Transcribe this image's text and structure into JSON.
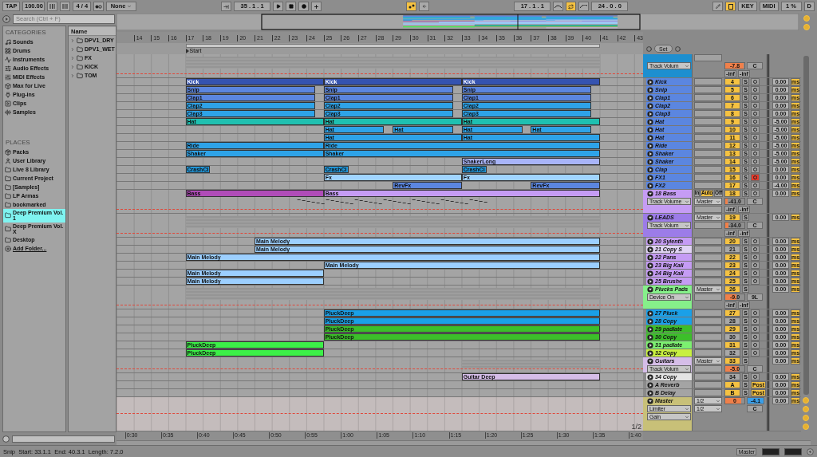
{
  "transport": {
    "tap": "TAP",
    "tempo": "100.00",
    "signature": "4 / 4",
    "quantize": "None",
    "position": "35 .  1 .  1",
    "loop_start": "17 .  1 .  1",
    "loop_on": true,
    "loop_length": "24 .  0 .  0",
    "key": "KEY",
    "midi": "MIDI",
    "cpu": "1 %",
    "disk": "D"
  },
  "browser": {
    "search_placeholder": "Search (Ctrl + F)",
    "categories_title": "CATEGORIES",
    "categories": [
      {
        "label": "Sounds",
        "selected": false
      },
      {
        "label": "Drums",
        "selected": false
      },
      {
        "label": "Instruments",
        "selected": false
      },
      {
        "label": "Audio Effects",
        "selected": false
      },
      {
        "label": "MIDI Effects",
        "selected": false
      },
      {
        "label": "Max for Live",
        "selected": false
      },
      {
        "label": "Plug-ins",
        "selected": false
      },
      {
        "label": "Clips",
        "selected": false
      },
      {
        "label": "Samples",
        "selected": false
      }
    ],
    "places_title": "PLACES",
    "places": [
      {
        "label": "Packs",
        "selected": false
      },
      {
        "label": "User Library",
        "selected": false
      },
      {
        "label": "Live 8 Library",
        "selected": false
      },
      {
        "label": "Current Project",
        "selected": false
      },
      {
        "label": "[Samples]",
        "selected": false
      },
      {
        "label": "LP Armas",
        "selected": false
      },
      {
        "label": "bookmarked",
        "selected": false
      },
      {
        "label": "Deep Premium Vol. 1",
        "selected": true
      },
      {
        "label": "Deep Premium Vol. X",
        "selected": false
      },
      {
        "label": "Desktop",
        "selected": false
      }
    ],
    "add_folder": "Add Folder...",
    "column": "Name",
    "folders": [
      "DPV1_DRY",
      "DPV1_WET",
      "FX",
      "KICK",
      "TOM"
    ]
  },
  "ruler": {
    "bars": [
      "14",
      "15",
      "16",
      "17",
      "18",
      "19",
      "20",
      "21",
      "22",
      "23",
      "24",
      "25",
      "26",
      "27",
      "28",
      "29",
      "30",
      "31",
      "32",
      "33",
      "34",
      "35",
      "36",
      "37",
      "38",
      "39",
      "40",
      "41",
      "42",
      "43"
    ],
    "start_marker": "Start"
  },
  "set_button": "Set",
  "tracks": [
    {
      "kind": "group",
      "color": "#1d8fd0",
      "device": "Track Volum",
      "volume": {
        "text": "-7.8",
        "level": 0.95
      },
      "pan": "C",
      "inf": [
        "-inf",
        "-inf"
      ]
    },
    {
      "kind": "track",
      "name": "Kick",
      "color": "#5b86e0",
      "number": "4",
      "active": true,
      "solo": "S",
      "armed": false,
      "delay": "0.00",
      "unit": "ms",
      "clips": [
        {
          "name": "Kick",
          "color": "#3553b0"
        },
        {
          "name": "Kick",
          "color": "#3553b0"
        },
        {
          "name": "Kick",
          "color": "#3553b0"
        }
      ]
    },
    {
      "kind": "track",
      "name": "Snip",
      "color": "#5b86e0",
      "number": "5",
      "active": true,
      "solo": "S",
      "armed": false,
      "delay": "0.00",
      "unit": "ms",
      "clips": [
        {
          "name": "Snip",
          "color": "#5b86e0"
        },
        {
          "name": "Snip",
          "color": "#5b86e0"
        },
        {
          "name": "Snip",
          "color": "#5b86e0"
        }
      ]
    },
    {
      "kind": "track",
      "name": "Clap1",
      "color": "#5b86e0",
      "number": "6",
      "active": true,
      "solo": "S",
      "armed": false,
      "delay": "0.00",
      "unit": "ms",
      "clips": [
        {
          "name": "Clap1",
          "color": "#5b86e0"
        },
        {
          "name": "Clap1",
          "color": "#5b86e0"
        },
        {
          "name": "Clap1",
          "color": "#5b86e0"
        }
      ]
    },
    {
      "kind": "track",
      "name": "Clap2",
      "color": "#5b86e0",
      "number": "7",
      "active": true,
      "solo": "S",
      "armed": false,
      "delay": "0.00",
      "unit": "ms",
      "clips": [
        {
          "name": "Clap2",
          "color": "#2ea3e8"
        },
        {
          "name": "Clap2",
          "color": "#2ea3e8"
        },
        {
          "name": "Clap2",
          "color": "#2ea3e8"
        }
      ]
    },
    {
      "kind": "track",
      "name": "Clap3",
      "color": "#5b86e0",
      "number": "8",
      "active": true,
      "solo": "S",
      "armed": false,
      "delay": "0.00",
      "unit": "ms",
      "clips": [
        {
          "name": "Clap3",
          "color": "#2ea3e8"
        },
        {
          "name": "Clap3",
          "color": "#2ea3e8"
        },
        {
          "name": "Clap3",
          "color": "#2ea3e8"
        }
      ]
    },
    {
      "kind": "track",
      "name": "Hat",
      "color": "#5b86e0",
      "number": "9",
      "active": true,
      "solo": "S",
      "armed": false,
      "delay": "-5.00",
      "unit": "ms",
      "clips": [
        {
          "name": "Hat",
          "color": "#1fc0b0"
        },
        {
          "name": "Hat",
          "color": "#1fc0b0"
        },
        {
          "name": "Hat",
          "color": "#1fc0b0"
        }
      ]
    },
    {
      "kind": "track",
      "name": "Hat",
      "color": "#5b86e0",
      "number": "10",
      "active": true,
      "solo": "S",
      "armed": false,
      "delay": "-5.00",
      "unit": "ms",
      "clips": [
        {
          "name": "Hat",
          "color": "#2ea3e8"
        },
        {
          "name": "Hat",
          "color": "#2ea3e8"
        },
        {
          "name": "Hat",
          "color": "#2ea3e8"
        },
        {
          "name": "Hat",
          "color": "#2ea3e8"
        }
      ]
    },
    {
      "kind": "track",
      "name": "Hat",
      "color": "#5b86e0",
      "number": "11",
      "active": true,
      "solo": "S",
      "armed": false,
      "delay": "-5.00",
      "unit": "ms",
      "clips": [
        {
          "name": "Hat",
          "color": "#2ea3e8"
        },
        {
          "name": "Hat",
          "color": "#2ea3e8"
        }
      ]
    },
    {
      "kind": "track",
      "name": "Ride",
      "color": "#5b86e0",
      "number": "12",
      "active": true,
      "solo": "S",
      "armed": false,
      "delay": "-5.00",
      "unit": "ms",
      "clips": [
        {
          "name": "Ride",
          "color": "#2ea3e8"
        },
        {
          "name": "Ride",
          "color": "#2ea3e8"
        }
      ]
    },
    {
      "kind": "track",
      "name": "Shaker",
      "color": "#5b86e0",
      "number": "13",
      "active": true,
      "solo": "S",
      "armed": false,
      "delay": "-5.00",
      "unit": "ms",
      "clips": [
        {
          "name": "Shaker",
          "color": "#2ea3e8"
        },
        {
          "name": "Shaker",
          "color": "#2ea3e8"
        }
      ]
    },
    {
      "kind": "track",
      "name": "Shaker",
      "color": "#5b86e0",
      "number": "14",
      "active": true,
      "solo": "S",
      "armed": false,
      "delay": "-5.00",
      "unit": "ms",
      "clips": [
        {
          "name": "ShakerLong",
          "color": "#a8b4f8"
        }
      ]
    },
    {
      "kind": "track",
      "name": "Clap",
      "color": "#5b86e0",
      "number": "15",
      "active": true,
      "solo": "S",
      "armed": false,
      "delay": "0.00",
      "unit": "ms",
      "clips": [
        {
          "name": "CrashCl",
          "color": "#2196d8"
        },
        {
          "name": "CrashCl",
          "color": "#2196d8"
        },
        {
          "name": "CrashCl",
          "color": "#2196d8"
        }
      ]
    },
    {
      "kind": "track",
      "name": "FX1",
      "color": "#5b86e0",
      "number": "16",
      "active": true,
      "solo": "S",
      "armed": true,
      "delay": "0.00",
      "unit": "ms",
      "clips": [
        {
          "name": "Fx",
          "color": "#a0d4ff"
        },
        {
          "name": "Fx",
          "color": "#a0d4ff"
        }
      ]
    },
    {
      "kind": "track",
      "name": "FX2",
      "color": "#5b86e0",
      "number": "17",
      "active": true,
      "solo": "S",
      "armed": false,
      "delay": "-4.00",
      "unit": "ms",
      "clips": [
        {
          "name": "RevFx",
          "color": "#5b86e0"
        },
        {
          "name": "RevFx",
          "color": "#5b86e0"
        }
      ]
    },
    {
      "kind": "midi",
      "name": "18 Bass",
      "color": "#c59cf4",
      "monitor": [
        {
          "label": "In",
          "selected": false
        },
        {
          "label": "Auto",
          "selected": true
        },
        {
          "label": "Off",
          "selected": false
        }
      ],
      "output": "Master",
      "device": "Track Volume",
      "number": "18",
      "active": true,
      "solo": "S",
      "armed": false,
      "volume": {
        "text": "-41.0",
        "level": 0.12
      },
      "pan": "C",
      "inf": [
        "-inf",
        "-inf"
      ],
      "delay": "0.00",
      "unit": "ms",
      "clips": [
        {
          "name": "Bass",
          "color": "#b04cb8"
        },
        {
          "name": "Bass",
          "color": "#c59cf4"
        }
      ]
    },
    {
      "kind": "group",
      "name": "LEADS",
      "color": "#9c7ce8",
      "output": "Master",
      "number": "19",
      "active": true,
      "solo": "S",
      "volume": {
        "text": "-34.0",
        "level": 0.18
      },
      "pan": "C",
      "inf": [
        "-inf",
        "-inf"
      ],
      "device": "Track Volum",
      "delay": "0.00",
      "unit": "ms"
    },
    {
      "kind": "track",
      "name": "20 Sylenth",
      "color": "#c59cf4",
      "number": "20",
      "active": true,
      "solo": "S",
      "armed": false,
      "delay": "0.00",
      "unit": "ms",
      "clips": [
        {
          "name": "Main Melody",
          "color": "#9ccfff"
        }
      ]
    },
    {
      "kind": "track",
      "name": "21 Copy S",
      "color": "#e0d4f4",
      "number": "21",
      "active": false,
      "solo": "S",
      "armed": false,
      "delay": "0.00",
      "unit": "ms",
      "clips": [
        {
          "name": "Main Melody",
          "color": "#9ccfff"
        }
      ]
    },
    {
      "kind": "track",
      "name": "22 Pans",
      "color": "#c59cf4",
      "number": "22",
      "active": true,
      "solo": "S",
      "armed": false,
      "delay": "0.00",
      "unit": "ms",
      "clips": [
        {
          "name": "Main Melody",
          "color": "#9ccfff"
        }
      ]
    },
    {
      "kind": "track",
      "name": "23 Big Kali",
      "color": "#c59cf4",
      "number": "23",
      "active": true,
      "solo": "S",
      "armed": false,
      "delay": "0.00",
      "unit": "ms",
      "clips": [
        {
          "name": "Main Melody",
          "color": "#9ccfff"
        }
      ]
    },
    {
      "kind": "track",
      "name": "24 Big Kali",
      "color": "#c59cf4",
      "number": "24",
      "active": true,
      "solo": "S",
      "armed": false,
      "delay": "0.00",
      "unit": "ms",
      "clips": [
        {
          "name": "Main Melody",
          "color": "#9ccfff"
        }
      ]
    },
    {
      "kind": "track",
      "name": "25 Brushe",
      "color": "#c59cf4",
      "number": "25",
      "active": true,
      "solo": "S",
      "armed": false,
      "delay": "0.00",
      "unit": "ms",
      "clips": [
        {
          "name": "Main Melody",
          "color": "#9ccfff"
        }
      ]
    },
    {
      "kind": "group",
      "name": "Plucks Pads",
      "color": "#86f08a",
      "output": "Master",
      "number": "26",
      "active": true,
      "solo": "S",
      "volume": {
        "text": "-9.0",
        "level": 0.6
      },
      "pan": "9L",
      "inf": [
        "-inf",
        "-inf"
      ],
      "device": "Device On",
      "delay": "0.00",
      "unit": "ms"
    },
    {
      "kind": "track",
      "name": "27 Pluck",
      "color": "#1aa0e8",
      "number": "27",
      "active": true,
      "solo": "S",
      "armed": false,
      "delay": "0.00",
      "unit": "ms",
      "clips": [
        {
          "name": "PluckDeep",
          "color": "#1aa0e8"
        }
      ]
    },
    {
      "kind": "track",
      "name": "28 Copy",
      "color": "#1aa0e8",
      "number": "28",
      "active": false,
      "solo": "S",
      "armed": false,
      "delay": "0.00",
      "unit": "ms",
      "clips": [
        {
          "name": "PluckDeep",
          "color": "#1aa0e8"
        }
      ]
    },
    {
      "kind": "track",
      "name": "29 padlate",
      "color": "#3cbf2a",
      "number": "29",
      "active": true,
      "solo": "S",
      "armed": false,
      "delay": "0.00",
      "unit": "ms",
      "clips": [
        {
          "name": "PluckDeep",
          "color": "#3cbf2a"
        }
      ]
    },
    {
      "kind": "track",
      "name": "30 Copy",
      "color": "#3cbf2a",
      "number": "30",
      "active": false,
      "solo": "S",
      "armed": false,
      "delay": "0.00",
      "unit": "ms",
      "clips": [
        {
          "name": "PluckDeep",
          "color": "#3cbf2a"
        }
      ]
    },
    {
      "kind": "track",
      "name": "31 padlate",
      "color": "#7cf070",
      "number": "31",
      "active": true,
      "solo": "S",
      "armed": false,
      "delay": "0.00",
      "unit": "ms",
      "clips": [
        {
          "name": "PluckDeep",
          "color": "#3cf048"
        }
      ]
    },
    {
      "kind": "track",
      "name": "32 Copy",
      "color": "#c8f040",
      "number": "32",
      "active": false,
      "solo": "S",
      "armed": false,
      "delay": "0.00",
      "unit": "ms",
      "clips": [
        {
          "name": "PluckDeep",
          "color": "#3cf048"
        }
      ]
    },
    {
      "kind": "group",
      "name": "Guitars",
      "color": "#d5bde8",
      "output": "Master",
      "number": "33",
      "active": true,
      "solo": "S",
      "device": "Track Volum",
      "volume": {
        "text": "-5.0",
        "level": 0.7
      },
      "pan": "C",
      "delay": "0.00",
      "unit": "ms"
    },
    {
      "kind": "track",
      "name": "34 Copy",
      "color": "#e4e4e4",
      "number": "34",
      "active": false,
      "solo": "S",
      "armed": false,
      "delay": "0.00",
      "unit": "ms",
      "clips": [
        {
          "name": "Guitar Deep",
          "color": "#d5bde8"
        }
      ]
    },
    {
      "kind": "return",
      "name": "A Reverb",
      "color": "#a4a4a4",
      "number": "A",
      "active": true,
      "solo": "S",
      "post": "Post",
      "delay": "0.00",
      "unit": "ms"
    },
    {
      "kind": "return",
      "name": "B Delay",
      "color": "#a4a4a4",
      "number": "B",
      "active": true,
      "solo": "S",
      "post": "Post",
      "delay": "0.00",
      "unit": "ms"
    },
    {
      "kind": "master",
      "name": "Master",
      "color": "#c8c078",
      "io": [
        "1/2",
        "1/2"
      ],
      "devices": [
        "Limiter",
        "Gain"
      ],
      "volume": {
        "text": "0",
        "level": 0.85
      },
      "gain": "-4.1",
      "pan": "C",
      "delay": "0.00",
      "unit": "ms"
    }
  ],
  "time_ruler": [
    "0:30",
    "0:35",
    "0:40",
    "0:45",
    "0:50",
    "0:55",
    "1:00",
    "1:05",
    "1:10",
    "1:15",
    "1:20",
    "1:25",
    "1:30",
    "1:35",
    "1:40"
  ],
  "page": "1/2",
  "status": {
    "text": "Snip  Start: 33.1.1  End: 40.3.1  Length: 7.2.0",
    "output": "Master"
  }
}
